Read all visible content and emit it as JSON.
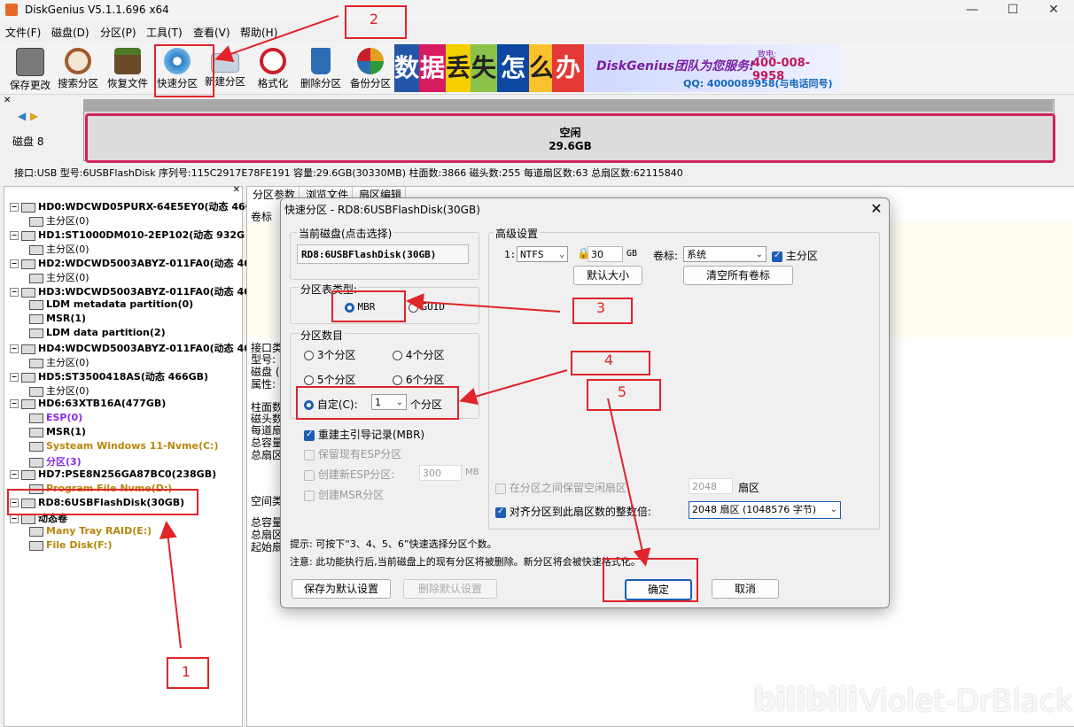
{
  "window": {
    "title": "DiskGenius V5.1.1.696 x64",
    "min": "—",
    "max": "☐",
    "close": "✕"
  },
  "menu": [
    "文件(F)",
    "磁盘(D)",
    "分区(P)",
    "工具(T)",
    "查看(V)",
    "帮助(H)"
  ],
  "toolbar": [
    {
      "label": "保存更改",
      "icon": "save-icon",
      "color": "#6a6a6a"
    },
    {
      "label": "搜索分区",
      "icon": "search-icon",
      "color": "#a05a2c"
    },
    {
      "label": "恢复文件",
      "icon": "recover-icon",
      "color": "#4d7a2a"
    },
    {
      "label": "快速分区",
      "icon": "quick-partition-icon",
      "color": "#2d7fc1"
    },
    {
      "label": "新建分区",
      "icon": "new-partition-icon",
      "color": "#8aa0b8"
    },
    {
      "label": "格式化",
      "icon": "format-icon",
      "color": "#c8202a"
    },
    {
      "label": "删除分区",
      "icon": "delete-icon",
      "color": "#2c6db3"
    },
    {
      "label": "备份分区",
      "icon": "backup-icon",
      "color": "#e0a020"
    }
  ],
  "ad": {
    "chars": [
      "数",
      "据",
      "丢",
      "失",
      "怎",
      "么",
      "办"
    ],
    "slogan": "DiskGenius团队为您服务!",
    "phone": "400-008-9958",
    "qq": "QQ: 4000089958(与电话同号)",
    "tel_label": "致电:"
  },
  "diskmap": {
    "disk_label": "磁盘 8",
    "free_label": "空闲",
    "free_size": "29.6GB"
  },
  "diskinfo": "接口:USB  型号:6USBFlashDisk  序列号:115C2917E78FE191  容量:29.6GB(30330MB)  柱面数:3866  磁头数:255  每道扇区数:63  总扇区数:62115840",
  "tree": [
    {
      "text": "HD0:WDCWD05PURX-64E5EY0(动态 466",
      "level": 0,
      "color": "#000",
      "bold": true
    },
    {
      "text": "主分区(0)",
      "level": 1,
      "color": "#000",
      "bold": false
    },
    {
      "text": "HD1:ST1000DM010-2EP102(动态 932G",
      "level": 0,
      "color": "#000",
      "bold": true
    },
    {
      "text": "主分区(0)",
      "level": 1,
      "color": "#000",
      "bold": false
    },
    {
      "text": "HD2:WDCWD5003ABYZ-011FA0(动态 46",
      "level": 0,
      "color": "#000",
      "bold": true
    },
    {
      "text": "主分区(0)",
      "level": 1,
      "color": "#000",
      "bold": false
    },
    {
      "text": "HD3:WDCWD5003ABYZ-011FA0(动态 46",
      "level": 0,
      "color": "#000",
      "bold": true
    },
    {
      "text": "LDM metadata partition(0)",
      "level": 1,
      "color": "#000",
      "bold": true
    },
    {
      "text": "MSR(1)",
      "level": 1,
      "color": "#000",
      "bold": true
    },
    {
      "text": "LDM data partition(2)",
      "level": 1,
      "color": "#000",
      "bold": true
    },
    {
      "text": "HD4:WDCWD5003ABYZ-011FA0(动态 46",
      "level": 0,
      "color": "#000",
      "bold": true
    },
    {
      "text": "主分区(0)",
      "level": 1,
      "color": "#000",
      "bold": false
    },
    {
      "text": "HD5:ST3500418AS(动态 466GB)",
      "level": 0,
      "color": "#000",
      "bold": true
    },
    {
      "text": "主分区(0)",
      "level": 1,
      "color": "#000",
      "bold": false
    },
    {
      "text": "HD6:63XTB16A(477GB)",
      "level": 0,
      "color": "#000",
      "bold": true
    },
    {
      "text": "ESP(0)",
      "level": 1,
      "color": "#8a2be2",
      "bold": true
    },
    {
      "text": "MSR(1)",
      "level": 1,
      "color": "#000",
      "bold": true
    },
    {
      "text": "Systeam Windows 11-Nvme(C:)",
      "level": 1,
      "color": "#b8860b",
      "bold": true
    },
    {
      "text": "分区(3)",
      "level": 1,
      "color": "#8a2be2",
      "bold": true
    },
    {
      "text": "HD7:PSE8N256GA87BC0(238GB)",
      "level": 0,
      "color": "#000",
      "bold": true
    },
    {
      "text": "Program File Nvme(D:)",
      "level": 1,
      "color": "#b8860b",
      "bold": true
    },
    {
      "text": "RD8:6USBFlashDisk(30GB)",
      "level": 0,
      "color": "#000",
      "bold": true
    },
    {
      "text": "动态卷",
      "level": 0,
      "color": "#000",
      "bold": true
    },
    {
      "text": "Many Tray RAID(E:)",
      "level": 1,
      "color": "#b8860b",
      "bold": true
    },
    {
      "text": "File Disk(F:)",
      "level": 1,
      "color": "#b8860b",
      "bold": true
    }
  ],
  "rightpanel": {
    "tabs": [
      "分区参数",
      "浏览文件",
      "扇区编辑"
    ],
    "labels": [
      "卷标",
      "接口类",
      "型号:",
      "磁盘 (",
      "属性:",
      "柱面数",
      "磁头数",
      "每道扇",
      "总容量",
      "总扇区",
      "空间类",
      "总容量",
      "总扇区",
      "起始扇"
    ]
  },
  "dialog": {
    "title": "快速分区 - RD8:6USBFlashDisk(30GB)",
    "current_disk_label": "当前磁盘(点击选择)",
    "current_disk_value": "RD8:6USBFlashDisk(30GB)",
    "ptype_label": "分区表类型:",
    "ptype_mbr": "MBR",
    "ptype_guid": "GUID",
    "count_label": "分区数目",
    "count_opts": [
      "3个分区",
      "4个分区",
      "5个分区",
      "6个分区"
    ],
    "custom_label": "自定(C):",
    "custom_value": "1",
    "custom_unit": "个分区",
    "rebuild_mbr": "重建主引导记录(MBR)",
    "keep_esp": "保留现有ESP分区",
    "create_esp": "创建新ESP分区:",
    "esp_size": "300",
    "esp_unit": "MB",
    "create_msr": "创建MSR分区",
    "adv_label": "高级设置",
    "adv_idx": "1:",
    "fs": "NTFS",
    "size": "30",
    "size_unit": "GB",
    "vol_label": "卷标:",
    "vol_value": "系统",
    "primary": "主分区",
    "default_size_btn": "默认大小",
    "clear_labels_btn": "清空所有卷标",
    "keep_free": "在分区之间保留空闲扇区",
    "keep_free_value": "2048",
    "keep_free_unit": "扇区",
    "align_label": "对齐分区到此扇区数的整数倍:",
    "align_value": "2048 扇区 (1048576 字节)",
    "hint": "提示: 可按下“3、4、5、6”快速选择分区个数。",
    "note": "注意: 此功能执行后,当前磁盘上的现有分区将被删除。新分区将会被快速格式化。",
    "save_default_btn": "保存为默认设置",
    "delete_default_btn": "删除默认设置",
    "ok_btn": "确定",
    "cancel_btn": "取消"
  },
  "annotations": [
    "1",
    "2",
    "3",
    "4",
    "5"
  ],
  "watermark": "Violet-DrBlack",
  "watermark_logo": "bilibili"
}
